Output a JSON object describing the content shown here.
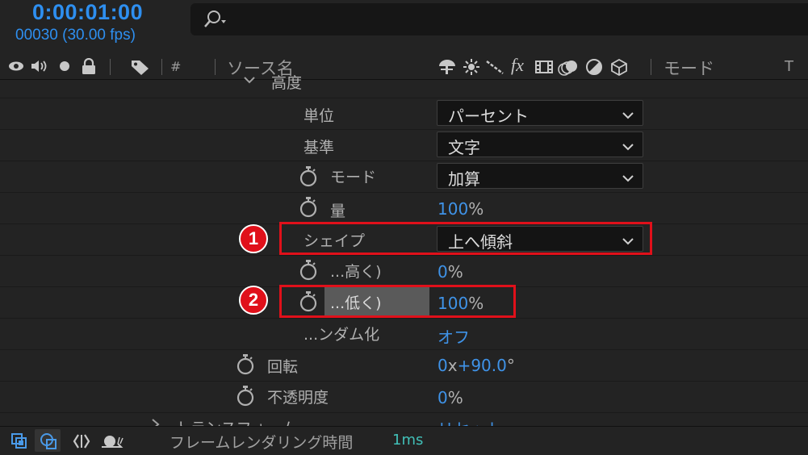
{
  "header": {
    "timecode": "0:00:01:00",
    "frame_info": "00030 (30.00 fps)"
  },
  "column_header": {
    "hash_label": "#",
    "source_name_label": "ソース名",
    "fx_label": "fx",
    "mode_label": "モード",
    "track_label": "T"
  },
  "properties": {
    "cut_top_label": "高度",
    "unit_label": "単位",
    "unit_value": "パーセント",
    "basis_label": "基準",
    "basis_value": "文字",
    "mode_label": "モード",
    "mode_value": "加算",
    "amount_label": "量",
    "amount_num": "100",
    "amount_pct": "%",
    "shape_label": "シェイプ",
    "shape_value": "上へ傾斜",
    "high_label": "...高く)",
    "high_num": "0",
    "high_pct": "%",
    "low_label": "...低く)",
    "low_num": "100",
    "low_pct": "%",
    "random_label": "...ンダム化",
    "random_value": "オフ",
    "rotation_label": "回転",
    "rotation_a": "0",
    "rotation_x": "x",
    "rotation_b": "+90.0",
    "rotation_deg": "°",
    "opacity_label": "不透明度",
    "opacity_num": "0",
    "opacity_pct": "%",
    "transform_label": "トランスフォーム",
    "transform_value": "リセット"
  },
  "callouts": {
    "one": "1",
    "two": "2"
  },
  "footer": {
    "render_label": "フレームレンダリング時間",
    "render_value": "1ms"
  },
  "colors": {
    "accent_blue": "#3f93e8",
    "highlight_red": "#e0101a",
    "render_time": "#41c0b8"
  }
}
